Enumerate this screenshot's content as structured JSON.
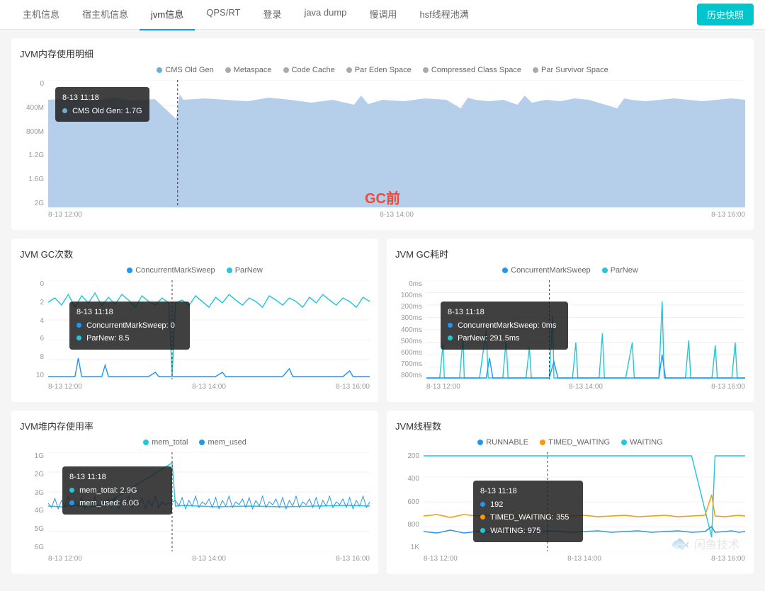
{
  "nav": {
    "tabs": [
      {
        "label": "主机信息",
        "active": false
      },
      {
        "label": "宿主机信息",
        "active": false
      },
      {
        "label": "jvm信息",
        "active": true
      },
      {
        "label": "QPS/RT",
        "active": false
      },
      {
        "label": "登录",
        "active": false
      },
      {
        "label": "java dump",
        "active": false
      },
      {
        "label": "慢调用",
        "active": false
      },
      {
        "label": "hsf线程池满",
        "active": false
      }
    ],
    "historyBtn": "历史快照"
  },
  "sections": {
    "memoryTitle": "JVM内存使用明细",
    "gcCountTitle": "JVM GC次数",
    "gcTimeTitle": "JVM GC耗时",
    "heapTitle": "JVM堆内存使用率",
    "threadTitle": "JVM线程数"
  },
  "memoryLegend": [
    {
      "label": "CMS Old Gen",
      "color": "#6baed6"
    },
    {
      "label": "Metaspace",
      "color": "#aaa"
    },
    {
      "label": "Code Cache",
      "color": "#aaa"
    },
    {
      "label": "Par Eden Space",
      "color": "#aaa"
    },
    {
      "label": "Compressed Class Space",
      "color": "#aaa"
    },
    {
      "label": "Par Survivor Space",
      "color": "#aaa"
    }
  ],
  "memoryTooltip": {
    "time": "8-13 11:18",
    "label": "CMS Old Gen:",
    "value": "1.7G"
  },
  "memoryYAxis": [
    "2G",
    "1.6G",
    "1.2G",
    "800M",
    "400M",
    "0"
  ],
  "memoryXAxis": [
    "8-13 12:00",
    "8-13 14:00",
    "8-13 16:00"
  ],
  "gcLabel": "GC前",
  "gcCountLegend": [
    {
      "label": "ConcurrentMarkSweep",
      "color": "#2196f3"
    },
    {
      "label": "ParNew",
      "color": "#26c6da"
    }
  ],
  "gcCountTooltip": {
    "time": "8-13 11:18",
    "items": [
      {
        "label": "ConcurrentMarkSweep:",
        "value": "0",
        "color": "#2196f3"
      },
      {
        "label": "ParNew:",
        "value": "8.5",
        "color": "#26c6da"
      }
    ]
  },
  "gcCountYAxis": [
    "10",
    "8",
    "6",
    "4",
    "2",
    "0"
  ],
  "gcCountXAxis": [
    "8-13 12:00",
    "8-13 14:00",
    "8-13 16:00"
  ],
  "gcTimeLegend": [
    {
      "label": "ConcurrentMarkSweep",
      "color": "#2196f3"
    },
    {
      "label": "ParNew",
      "color": "#26c6da"
    }
  ],
  "gcTimeTooltip": {
    "time": "8-13 11:18",
    "items": [
      {
        "label": "ConcurrentMarkSweep:",
        "value": "0ms",
        "color": "#2196f3"
      },
      {
        "label": "ParNew:",
        "value": "291.5ms",
        "color": "#26c6da"
      }
    ]
  },
  "gcTimeYAxis": [
    "800ms",
    "700ms",
    "600ms",
    "500ms",
    "400ms",
    "300ms",
    "200ms",
    "100ms",
    "0ms"
  ],
  "gcTimeXAxis": [
    "8-13 12:00",
    "8-13 14:00",
    "8-13 16:00"
  ],
  "heapLegend": [
    {
      "label": "mem_total",
      "color": "#26c6da"
    },
    {
      "label": "mem_used",
      "color": "#2196f3"
    }
  ],
  "heapTooltip": {
    "time": "8-13 11:18",
    "items": [
      {
        "label": "mem_total:",
        "value": "2.9G",
        "color": "#26c6da"
      },
      {
        "label": "mem_used:",
        "value": "6.0G",
        "color": "#2196f3"
      }
    ]
  },
  "heapYAxis": [
    "6G",
    "5G",
    "4G",
    "3G",
    "2G",
    "1G"
  ],
  "heapXAxis": [
    "8-13 12:00",
    "8-13 14:00",
    "8-13 16:00"
  ],
  "threadLegend": [
    {
      "label": "RUNNABLE",
      "color": "#2196f3"
    },
    {
      "label": "TIMED_WAITING",
      "color": "#ff9800"
    },
    {
      "label": "WAITING",
      "color": "#26c6da"
    }
  ],
  "threadTooltip": {
    "time": "8-13 11:18",
    "items": [
      {
        "label": "192",
        "color": "#2196f3"
      },
      {
        "label": "TIMED_WAITING:",
        "value": "355",
        "color": "#ff9800"
      },
      {
        "label": "WAITING:",
        "value": "975",
        "color": "#26c6da"
      }
    ]
  },
  "threadYAxis": [
    "1K",
    "800",
    "600",
    "400",
    "200"
  ],
  "threadXAxis": [
    "8-13 12:00",
    "8-13 14:00",
    "8-13 16:00"
  ],
  "watermark": "闲鱼技术"
}
